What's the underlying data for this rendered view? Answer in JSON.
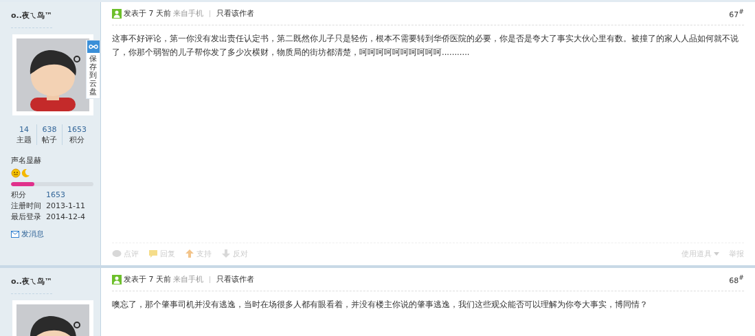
{
  "posts": [
    {
      "author": "o..夜ㄟ鸟™",
      "save_label": "保存到云盘",
      "stats": [
        {
          "value": "14",
          "label": "主题"
        },
        {
          "value": "638",
          "label": "帖子"
        },
        {
          "value": "1653",
          "label": "积分"
        }
      ],
      "rank": "声名显赫",
      "level": 0.28,
      "details": [
        {
          "label": "积分",
          "value": "1653",
          "link": true
        },
        {
          "label": "注册时间",
          "value": "2013-1-11",
          "link": false
        },
        {
          "label": "最后登录",
          "value": "2014-12-4",
          "link": false
        }
      ],
      "message_link": "发消息",
      "meta": {
        "posted": "发表于 7 天前",
        "source": "来自手机",
        "author_only": "只看该作者"
      },
      "floor": "67$^{#}$",
      "body": "这事不好评论，第一你没有发出责任认定书，第二既然你儿子只是轻伤，根本不需要转到华侨医院的必要，你是否是夸大了事实大伙心里有数。被撞了的家人人品如何就不说了，你那个弱智的儿子帮你发了多少次横财，物质局的街坊都清楚，呵呵呵呵呵呵呵呵呵呵...........",
      "actions": [
        {
          "kind": "comment",
          "label": "点评"
        },
        {
          "kind": "reply",
          "label": "回复"
        },
        {
          "kind": "support",
          "label": "支持"
        },
        {
          "kind": "oppose",
          "label": "反对"
        }
      ],
      "tools": "使用道具",
      "report": "举报"
    },
    {
      "author": "o..夜ㄟ鸟™",
      "meta": {
        "posted": "发表于 7 天前",
        "source": "来自手机",
        "author_only": "只看该作者"
      },
      "floor": "68$^{#}$",
      "body": "噢忘了，那个肇事司机并没有逃逸，当时在场很多人都有眼看着，并没有楼主你说的肇事逃逸，我们这些观众能否可以理解为你夸大事实，博同情？"
    }
  ]
}
